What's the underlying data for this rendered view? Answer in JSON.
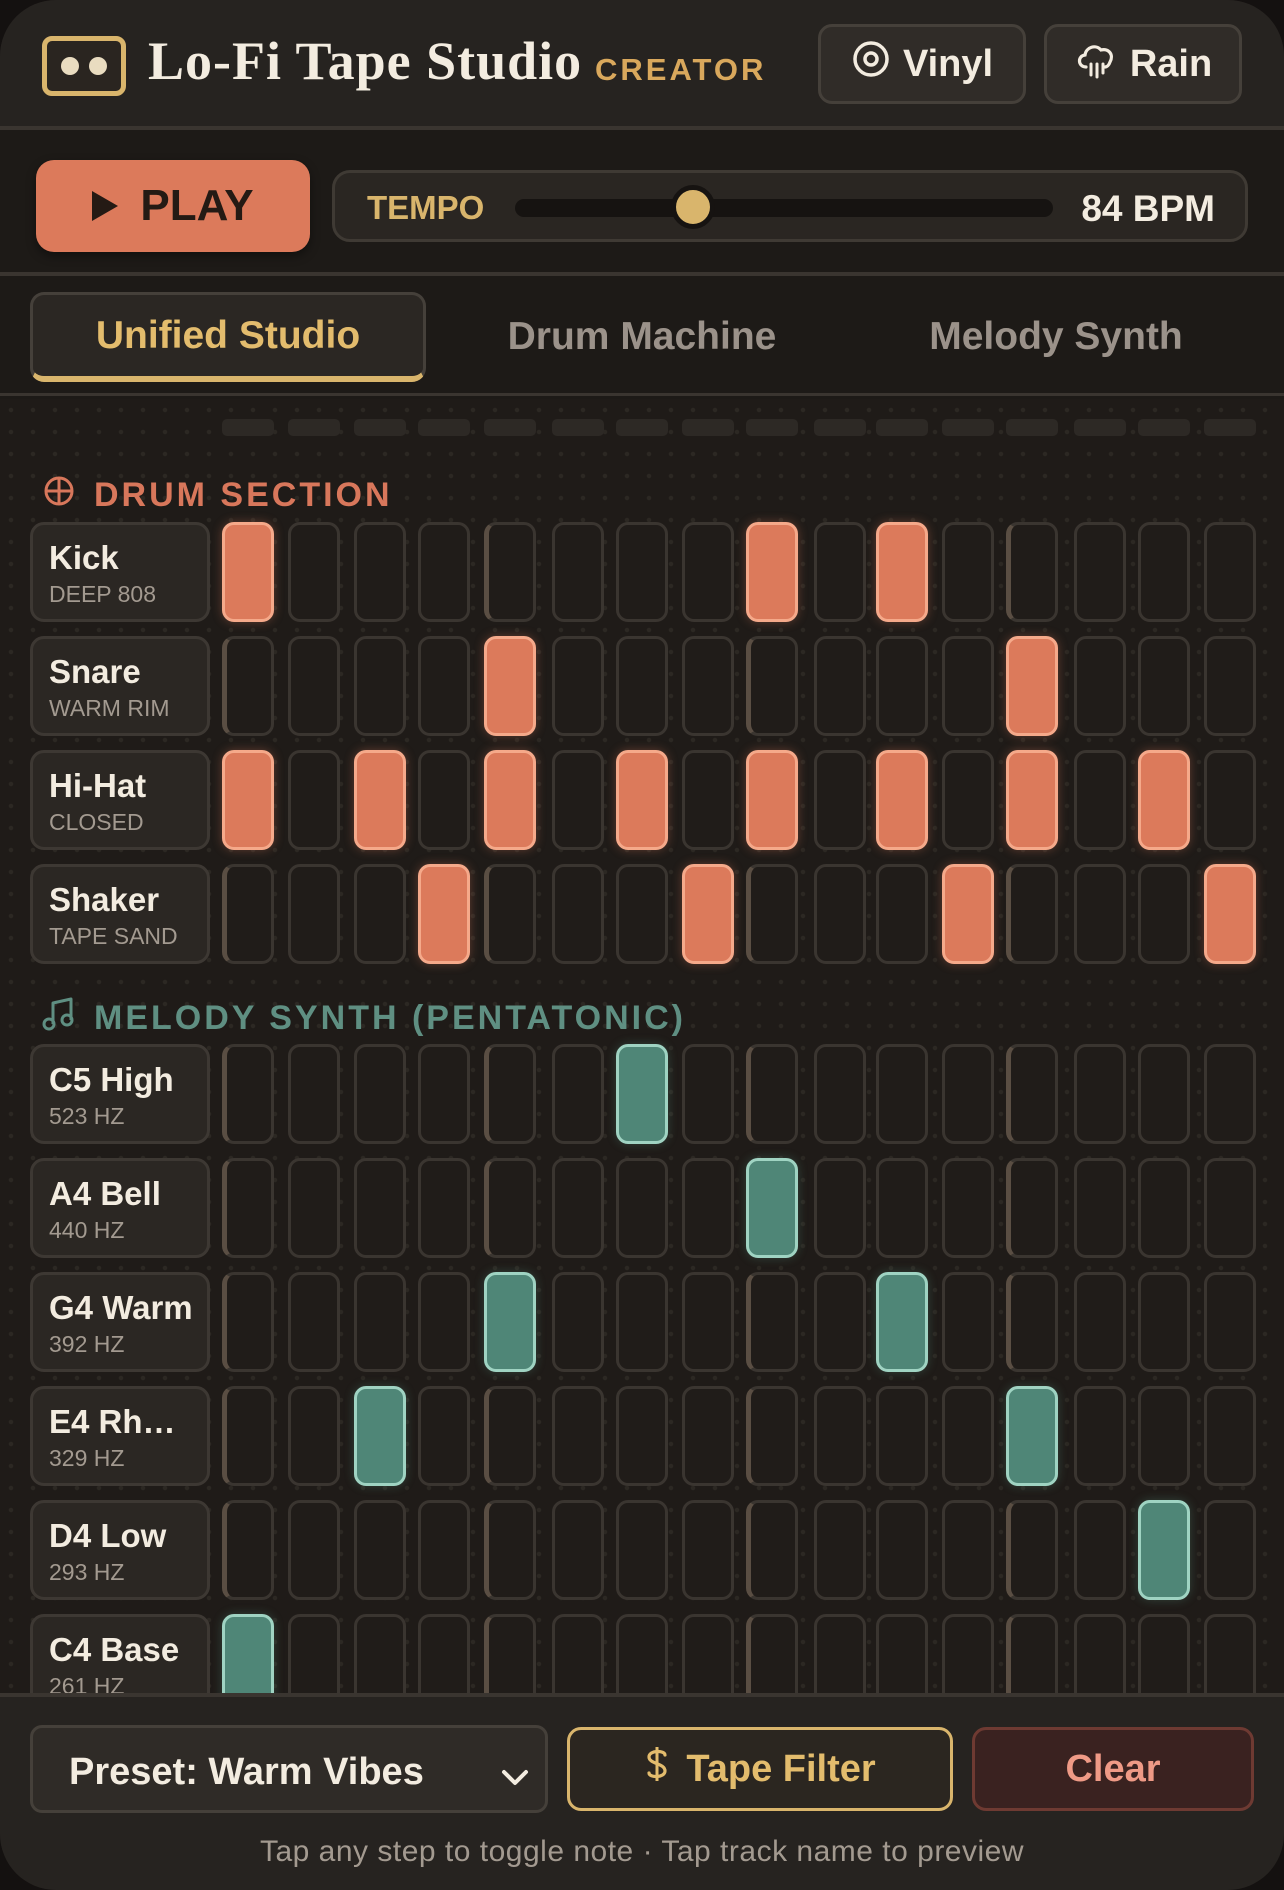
{
  "header": {
    "title": "Lo-Fi Tape Studio",
    "tier": "CREATOR",
    "vinyl_label": "Vinyl",
    "rain_label": "Rain"
  },
  "transport": {
    "play_label": "PLAY",
    "tempo_label": "TEMPO",
    "tempo_value": "84 BPM",
    "tempo_fraction": 0.33
  },
  "tabs": [
    {
      "label": "Unified Studio",
      "active": true
    },
    {
      "label": "Drum Machine",
      "active": false
    },
    {
      "label": "Melody Synth",
      "active": false
    }
  ],
  "steps": 16,
  "drum_section": {
    "title": "DRUM SECTION",
    "tracks": [
      {
        "name": "Kick",
        "sub": "DEEP 808",
        "steps": [
          1,
          0,
          0,
          0,
          0,
          0,
          0,
          0,
          1,
          0,
          1,
          0,
          0,
          0,
          0,
          0
        ]
      },
      {
        "name": "Snare",
        "sub": "WARM RIM",
        "steps": [
          0,
          0,
          0,
          0,
          1,
          0,
          0,
          0,
          0,
          0,
          0,
          0,
          1,
          0,
          0,
          0
        ]
      },
      {
        "name": "Hi-Hat",
        "sub": "CLOSED",
        "steps": [
          1,
          0,
          1,
          0,
          1,
          0,
          1,
          0,
          1,
          0,
          1,
          0,
          1,
          0,
          1,
          0
        ]
      },
      {
        "name": "Shaker",
        "sub": "TAPE SAND",
        "steps": [
          0,
          0,
          0,
          1,
          0,
          0,
          0,
          1,
          0,
          0,
          0,
          1,
          0,
          0,
          0,
          1
        ]
      }
    ]
  },
  "melody_section": {
    "title": "MELODY SYNTH (PENTATONIC)",
    "tracks": [
      {
        "name": "C5 High",
        "sub": "523 HZ",
        "steps": [
          0,
          0,
          0,
          0,
          0,
          0,
          1,
          0,
          0,
          0,
          0,
          0,
          0,
          0,
          0,
          0
        ]
      },
      {
        "name": "A4 Bell",
        "sub": "440 HZ",
        "steps": [
          0,
          0,
          0,
          0,
          0,
          0,
          0,
          0,
          1,
          0,
          0,
          0,
          0,
          0,
          0,
          0
        ]
      },
      {
        "name": "G4 Warm",
        "sub": "392 HZ",
        "steps": [
          0,
          0,
          0,
          0,
          1,
          0,
          0,
          0,
          0,
          0,
          1,
          0,
          0,
          0,
          0,
          0
        ]
      },
      {
        "name": "E4 Rh…",
        "sub": "329 HZ",
        "steps": [
          0,
          0,
          1,
          0,
          0,
          0,
          0,
          0,
          0,
          0,
          0,
          0,
          1,
          0,
          0,
          0
        ]
      },
      {
        "name": "D4 Low",
        "sub": "293 HZ",
        "steps": [
          0,
          0,
          0,
          0,
          0,
          0,
          0,
          0,
          0,
          0,
          0,
          0,
          0,
          0,
          1,
          0
        ]
      },
      {
        "name": "C4 Base",
        "sub": "261 HZ",
        "steps": [
          1,
          0,
          0,
          0,
          0,
          0,
          0,
          0,
          0,
          0,
          0,
          0,
          0,
          0,
          0,
          0
        ]
      }
    ]
  },
  "footer": {
    "preset_label": "Preset: Warm Vibes",
    "tape_filter_label": "Tape Filter",
    "clear_label": "Clear",
    "hint": "Tap any step to toggle note · Tap track name to preview"
  },
  "colors": {
    "accent_drum": "#dc7a5b",
    "accent_melody": "#4f8677",
    "accent_gold": "#d9b56c"
  }
}
